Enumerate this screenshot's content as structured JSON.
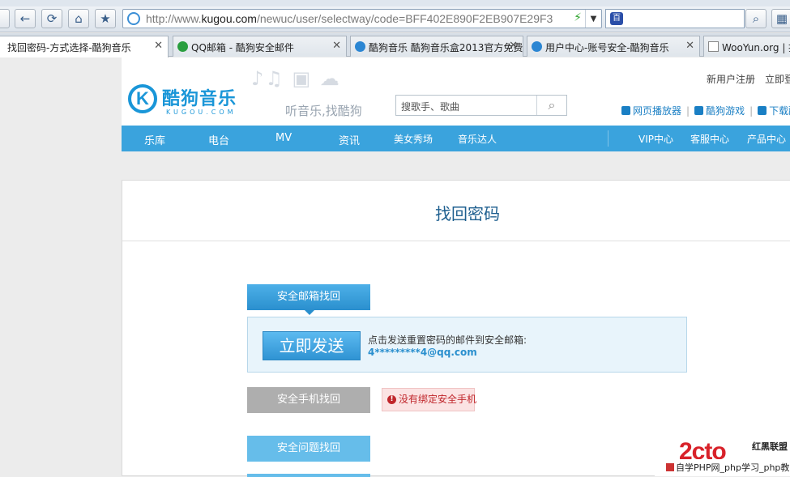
{
  "browser": {
    "url_prefix": "http://www.",
    "url_host": "kugou.com",
    "url_path": "/newuc/user/selectway/code=BFF402E890F2EB907E29F3",
    "tabs": [
      {
        "label": "找回密码-方式选择-酷狗音乐",
        "active": true
      },
      {
        "label": "QQ邮箱 - 酷狗安全邮件",
        "active": false
      },
      {
        "label": "酷狗音乐 酷狗音乐盒2013官方免费",
        "active": false
      },
      {
        "label": "用户中心-账号安全-酷狗音乐",
        "active": false
      },
      {
        "label": "WooYun.org | 提",
        "active": false
      }
    ]
  },
  "site": {
    "logo_k": "K",
    "logo_name": "酷狗音乐",
    "logo_sub": "KUGOU.COM",
    "slogan": "听音乐,找酷狗",
    "search_placeholder": "搜歌手、歌曲",
    "top_links": [
      "新用户注册",
      "立即登"
    ],
    "sub_links": [
      "网页播放器",
      "酷狗游戏",
      "下载酷"
    ],
    "nav": [
      "乐库",
      "电台",
      "MV",
      "资讯",
      "美女秀场",
      "音乐达人"
    ],
    "nav_right": [
      "VIP中心",
      "客服中心",
      "产品中心"
    ]
  },
  "main": {
    "title": "找回密码",
    "email_method": "安全邮箱找回",
    "send_button": "立即发送",
    "send_text": "点击发送重置密码的邮件到安全邮箱:",
    "email_masked": "4*********4@qq.com",
    "phone_method": "安全手机找回",
    "phone_warning": "没有绑定安全手机",
    "qa_method": "安全问题找回"
  },
  "watermark": {
    "logo": "2cto",
    "tag": "红黑联盟",
    "line": "自学PHP网_php学习_php教"
  },
  "colors": {
    "brand_blue": "#1a96d8",
    "nav_blue": "#3aa3dd",
    "warning_red": "#c0262b"
  }
}
